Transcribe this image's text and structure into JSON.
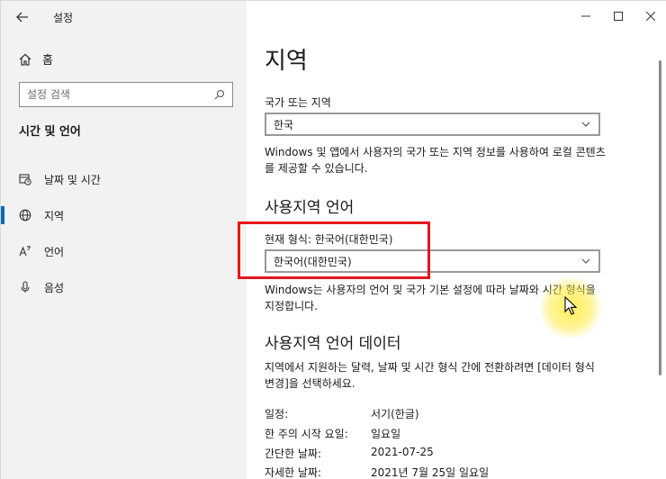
{
  "window": {
    "title": "설정"
  },
  "sidebar": {
    "home_label": "홈",
    "search_placeholder": "설정 검색",
    "section_title": "시간 및 언어",
    "items": [
      {
        "label": "날짜 및 시간",
        "icon": "calendar-clock-icon",
        "active": false
      },
      {
        "label": "지역",
        "icon": "globe-icon",
        "active": true
      },
      {
        "label": "언어",
        "icon": "language-icon",
        "active": false
      },
      {
        "label": "음성",
        "icon": "microphone-icon",
        "active": false
      }
    ]
  },
  "main": {
    "title": "지역",
    "country_label": "국가 또는 지역",
    "country_value": "한국",
    "country_desc": "Windows 및 앱에서 사용자의 국가 또는 지역 정보를 사용하여 로컬 콘텐츠를 제공할 수 있습니다.",
    "format_heading": "사용지역 언어",
    "format_label": "현재 형식: 한국어(대한민국)",
    "format_value": "한국어(대한민국)",
    "format_desc": "Windows는 사용자의 언어 및 국가 기본 설정에 따라 날짜와 시간 형식을 지정합니다.",
    "data_heading": "사용지역 언어 데이터",
    "data_desc": "지역에서 지원하는 달력, 날짜 및 시간 형식 간에 전환하려면 [데이터 형식 변경]을 선택하세요.",
    "rows": [
      {
        "key": "일정:",
        "value": "서기(한글)"
      },
      {
        "key": "한 주의 시작 요일:",
        "value": "일요일"
      },
      {
        "key": "간단한 날짜:",
        "value": "2021-07-25"
      },
      {
        "key": "자세한 날짜:",
        "value": "2021년 7월 25일 일요일"
      }
    ]
  },
  "colors": {
    "accent": "#0067c0",
    "highlight_box": "#e4161b",
    "cursor_glow": "#ffeb3c"
  }
}
